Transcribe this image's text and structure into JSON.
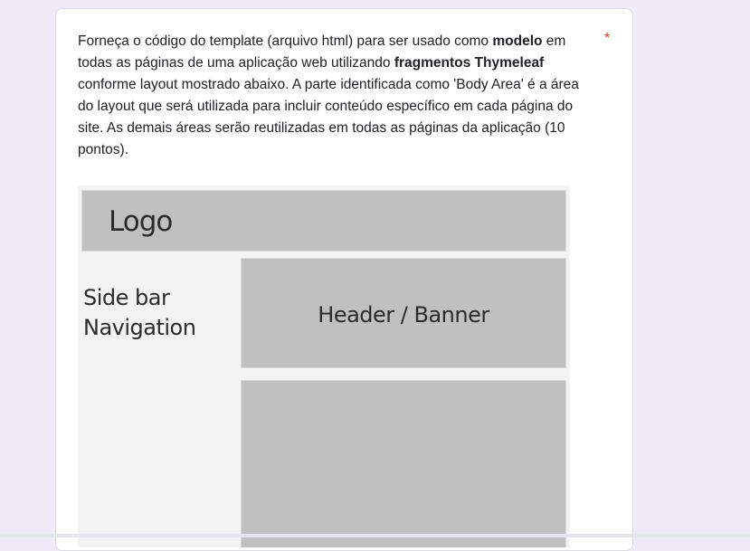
{
  "question": {
    "part1": "Forneça o código do template (arquivo html) para ser usado como ",
    "bold1": "modelo",
    "part2": " em todas as páginas de uma aplicação web utilizando ",
    "bold2": "fragmentos Thymeleaf",
    "part3": " conforme layout mostrado abaixo. A parte identificada como 'Body Area' é a área do layout que será utilizada para incluir conteúdo específico em cada página do site. As demais áreas serão reutilizadas em todas as páginas da aplicação (10 pontos).",
    "required_mark": "*"
  },
  "figure": {
    "logo": "Logo",
    "sidebar_line1": "Side bar",
    "sidebar_line2": "Navigation",
    "header": "Header / Banner"
  }
}
